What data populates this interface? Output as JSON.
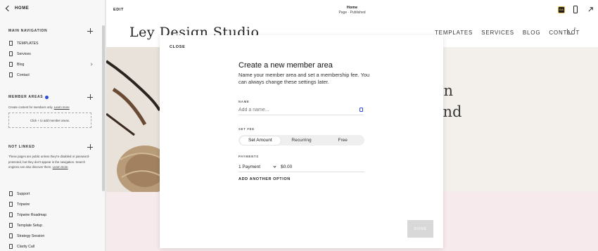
{
  "sidebar": {
    "home_label": "HOME",
    "main_navigation": {
      "heading": "MAIN NAVIGATION",
      "items": [
        "TEMPLATES",
        "Services",
        "Blog",
        "Contact"
      ]
    },
    "member_areas": {
      "heading": "MEMBER AREAS",
      "description": "Create content for members only.",
      "learn_more": "Learn more",
      "empty_hint": "Click + to add member areas."
    },
    "not_linked": {
      "heading": "NOT LINKED",
      "description": "These pages are public unless they're disabled or password-protected, but they don't appear in the navigation. Search engines can also discover them.",
      "learn_more": "Learn more",
      "items": [
        "Support",
        "Tripwire",
        "Tripwire Roadmap",
        "Template Setup",
        "Strategy Session",
        "Clarity Call"
      ]
    }
  },
  "topbar": {
    "edit_label": "EDIT",
    "page_title": "Home",
    "page_status": "Page · Published",
    "badge_label": "GA"
  },
  "site": {
    "logo": "Ley Design Studio",
    "nav": [
      "TEMPLATES",
      "SERVICES",
      "BLOG",
      "CONTACT"
    ],
    "cart_count": "0",
    "hero_line1": "gn",
    "hero_line2": "and"
  },
  "modal": {
    "close_label": "CLOSE",
    "title": "Create a new member area",
    "description": "Name your member area and set a membership fee. You can always change these settings later.",
    "name_label": "NAME",
    "name_placeholder": "Add a name...",
    "fee_label": "SET FEE",
    "fee_options": [
      "Set Amount",
      "Recurring",
      "Free"
    ],
    "fee_selected": "Set Amount",
    "payments_label": "PAYMENTS",
    "payment_count": "1 Payment",
    "payment_amount": "$0.00",
    "add_option_label": "ADD ANOTHER OPTION",
    "done_label": "DONE"
  }
}
